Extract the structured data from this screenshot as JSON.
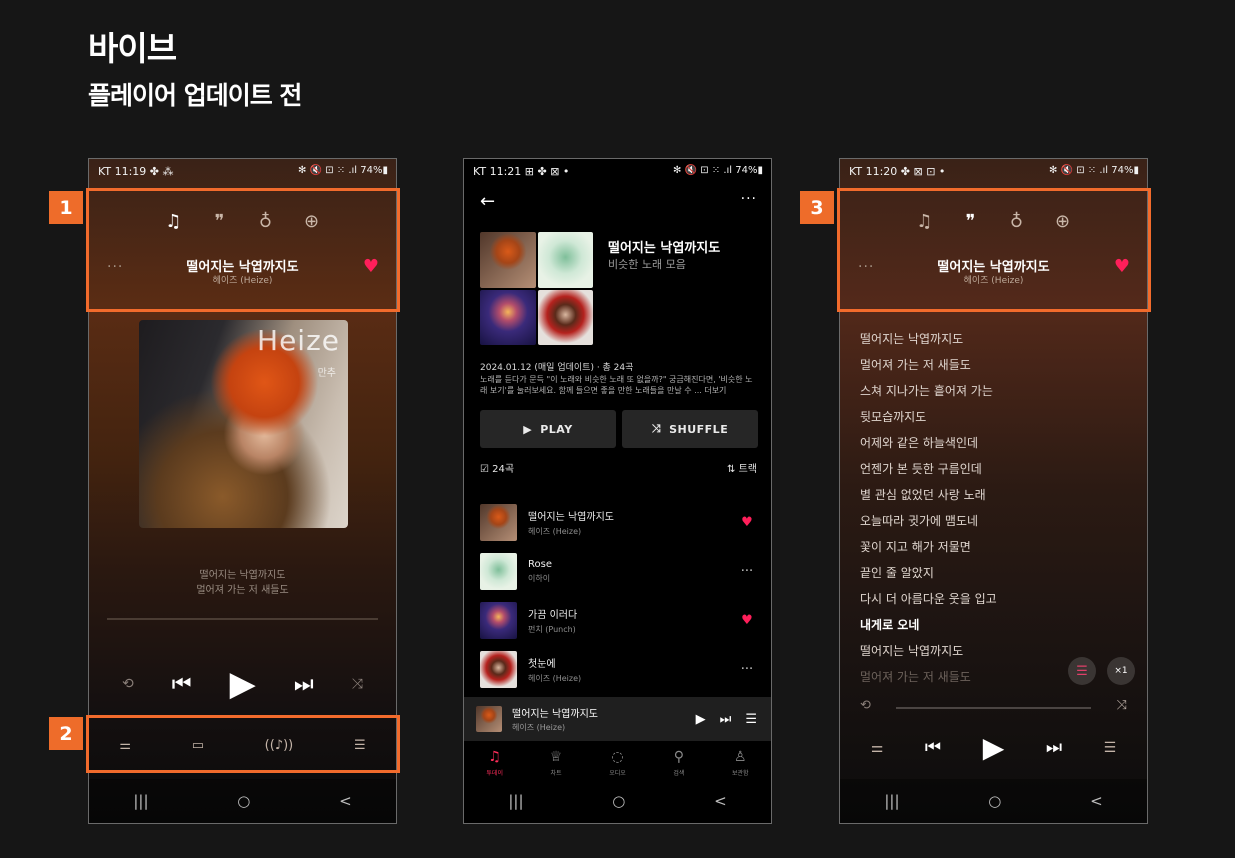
{
  "page": {
    "title": "바이브",
    "subtitle": "플레이어 업데이트 전"
  },
  "badges": [
    "1",
    "2",
    "3"
  ],
  "colors": {
    "accent": "#f26b2c",
    "heart": "#ff1f5a",
    "active_tab": "#ff2d5b"
  },
  "phone1": {
    "status": {
      "time": "KT 11:19 ✤ ⁂",
      "right": "✻ 🔇 ⊡ ⁙ .ıl 74%▮"
    },
    "header_icons": [
      "music-note-icon",
      "lyrics-bubble-icon",
      "mic-icon",
      "globe-icon"
    ],
    "more": "···",
    "song": {
      "title": "떨어지는 낙엽까지도",
      "artist": "헤이즈 (Heize)"
    },
    "album_text": {
      "word": "Heize",
      "sub": "만추"
    },
    "lyric_preview": [
      "떨어지는 낙엽까지도",
      "멀어져 가는 저 새들도"
    ],
    "controls": [
      "repeat-icon",
      "previous-icon",
      "play-icon",
      "next-icon",
      "shuffle-icon"
    ],
    "bottom_tools": [
      "equalizer-icon",
      "device-icon",
      "broadcast-icon",
      "playlist-icon"
    ],
    "nav": [
      "|||",
      "○",
      "<"
    ]
  },
  "phone2": {
    "status": {
      "time": "KT 11:21 ⊞ ✤ ⊠ •",
      "right": "✻ 🔇 ⊡ ⁙ .ıl 74%▮"
    },
    "back": "←",
    "more": "···",
    "playlist": {
      "title": "떨어지는 낙엽까지도",
      "subtitle": "비슷한 노래 모음",
      "meta": "2024.01.12 (매일 업데이트) · 총 24곡",
      "desc": "노래를 듣다가 문득 \"이 노래와 비슷한 노래 또 없을까?\" 궁금해진다면, '비슷한 노래 보기'를 눌러보세요. 함께 들으면 좋을 만한 노래들을 만날 수 ... 더보기"
    },
    "buttons": {
      "play": "PLAY",
      "shuffle": "SHUFFLE"
    },
    "count": "24곡",
    "sort": "⇅ 트랙",
    "tracks": [
      {
        "title": "떨어지는 낙엽까지도",
        "artist": "헤이즈 (Heize)",
        "action": "♥"
      },
      {
        "title": "Rose",
        "artist": "이하이",
        "action": "···"
      },
      {
        "title": "가끔 이러다",
        "artist": "펀치 (Punch)",
        "action": "♥"
      },
      {
        "title": "첫눈에",
        "artist": "헤이즈 (Heize)",
        "action": "···"
      }
    ],
    "mini_player": {
      "title": "떨어지는 낙엽까지도",
      "artist": "헤이즈 (Heize)"
    },
    "tabs": [
      {
        "icon": "♫",
        "label": "투데이"
      },
      {
        "icon": "♕",
        "label": "차트"
      },
      {
        "icon": "◌",
        "label": "오디오"
      },
      {
        "icon": "⚲",
        "label": "검색"
      },
      {
        "icon": "♙",
        "label": "보관함"
      }
    ],
    "nav": [
      "|||",
      "○",
      "<"
    ]
  },
  "phone3": {
    "status": {
      "time": "KT 11:20 ✤ ⊠ ⊡ •",
      "right": "✻ 🔇 ⊡ ⁙ .ıl 74%▮"
    },
    "more": "···",
    "song": {
      "title": "떨어지는 낙엽까지도",
      "artist": "헤이즈 (Heize)"
    },
    "lyrics": [
      "떨어지는 낙엽까지도",
      "멀어져 가는 저 새들도",
      "스쳐 지나가는 흩어져 가는",
      "뒷모습까지도",
      "어제와 같은 하늘색인데",
      "언젠가 본 듯한 구름인데",
      "별 관심 없었던 사랑 노래",
      "오늘따라 귓가에 맴도네",
      "꽃이 지고 해가 저물면",
      "끝인 줄 알았지",
      "다시 더 아름다운 웃을 입고",
      "내게로 오네",
      "떨어지는 낙엽까지도",
      "멀어져 가는 저 새들도"
    ],
    "speed": "×1",
    "nav": [
      "|||",
      "○",
      "<"
    ]
  }
}
